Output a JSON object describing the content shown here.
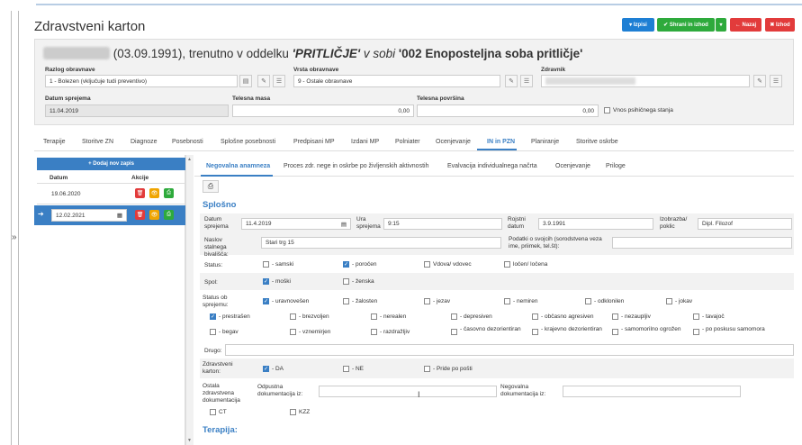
{
  "header": {
    "title": "Zdravstveni karton",
    "buttons": {
      "print": "Izpisi",
      "save_close": "Shrani in izhod",
      "back": "Nazaj",
      "exit": "Izhod"
    },
    "colors": {
      "print": "#1e7fd4",
      "save": "#2eaa3c",
      "back": "#e23b3b",
      "exit": "#e23b3b"
    }
  },
  "patient": {
    "heading_part1": "(03.09.1991), trenutno v oddelku ",
    "department": "'PRITLIČJE'",
    "heading_part2": " v sobi ",
    "room": "'002 Enoposteljna soba pritličje'",
    "reason_label": "Razlog obravnave",
    "reason_value": "1 - Bolezen (vključuje tudi preventivo)",
    "type_label": "Vrsta obravnave",
    "type_value": "9 - Ostale obravnave",
    "doctor_label": "Zdravnik",
    "admission_date_label": "Datum sprejema",
    "admission_date_value": "11.04.2019",
    "weight_label": "Telesna masa",
    "weight_value": "0,00",
    "surface_label": "Telesna površina",
    "surface_value": "0,00",
    "psych_label": "Vnos psihičnega stanja"
  },
  "main_tabs": [
    "Terapije",
    "Storitve ZN",
    "Diagnoze",
    "Posebnosti",
    "Splošne posebnosti",
    "Predpisani MP",
    "Izdani MP",
    "Polniater",
    "Ocenjevanje",
    "IN in PZN",
    "Planiranje",
    "Storitve oskrbe"
  ],
  "left_panel": {
    "add_button": "+ Dodaj nov zapis",
    "col_date": "Datum",
    "col_actions": "Akcije",
    "rows": [
      "19.06.2020",
      "12.02.2021"
    ]
  },
  "sub_tabs": [
    "Negovalna anamneza",
    "Proces zdr. nege in oskrbe po življenskih aktivnostih",
    "Evalvacija individualnega načrta",
    "Ocenjevanje",
    "Priloge"
  ],
  "form": {
    "section_general": "Splošno",
    "date_label": "Datum sprejema",
    "date_value": "11.4.2019",
    "time_label": "Ura sprejema",
    "time_value": "9:15",
    "birth_label": "Rojstni datum",
    "birth_value": "3.9.1991",
    "edu_label": "Izobrazba/ poklic",
    "edu_value": "Dipl. Filozof",
    "address_label": "Naslov stalnega bivališča:",
    "address_value": "Stari trg 15",
    "relatives_label": "Podatki o svojcih (sorodstvena veza ime, priimek, tel.št):",
    "status_label": "Status:",
    "status_options": [
      "- samski",
      "- poročen",
      "Vdova/ vdovec",
      "ločen/ ločena"
    ],
    "sex_label": "Spol:",
    "sex_options": [
      "- moški",
      "- ženska"
    ],
    "admission_status_label": "Status ob sprejemu:",
    "adm_row1": [
      "- uravnovešen",
      "- žalosten",
      "- jezav",
      "- nemiren",
      "- odklonilen",
      "- jokav"
    ],
    "adm_row2": [
      "- prestrašen",
      "- brezvoljen",
      "- nerealen",
      "- depresiven",
      "- občasno agresiven",
      "- nezaupljiv",
      "- tavajoč"
    ],
    "adm_row3": [
      "- begav",
      "- vznemirjen",
      "- razdražljiv",
      "- časovno dezorientiran",
      "- krajevno dezorientiran",
      "- samomorilno ogrožen",
      "- po poskusu samomora"
    ],
    "other_label": "Drugo:",
    "card_label": "Zdravstveni karton:",
    "card_options": [
      "- DA",
      "- NE",
      "- Pride po pošti"
    ],
    "other_docs_label": "Ostala zdravstvena dokumentacija",
    "discharge_label": "Odpustna dokumentacija iz:",
    "nursing_label": "Negovalna dokumentacija iz:",
    "doc_options": [
      "CT",
      "KZZ"
    ],
    "section_therapy": "Terapija:"
  }
}
